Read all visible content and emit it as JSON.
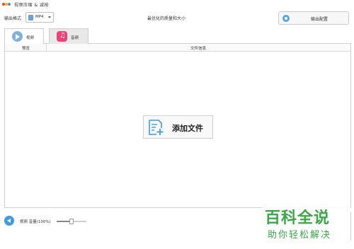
{
  "app": {
    "title": "视频压缩 & 减按",
    "logo_dots": [
      "#e94b3c",
      "#f4b400",
      "#4a90d9"
    ]
  },
  "toolbar": {
    "format_label": "输出格式",
    "format_value": "MP4",
    "quality_text": "最优化的质量和大小",
    "output_settings_label": "输出配置"
  },
  "tabs": [
    {
      "label": "视频",
      "icon": "play-icon",
      "active": true
    },
    {
      "label": "音频",
      "icon": "music-note-icon",
      "active": false
    }
  ],
  "list": {
    "col_preview": "预览",
    "col_file_info": "文件信息"
  },
  "add_file": {
    "label": "添加文件",
    "icon": "add-file-icon"
  },
  "bottom": {
    "volume_label": "视频 音量(100%)",
    "volume_percent": 100
  },
  "watermark": {
    "main": "百科全说",
    "sub": "助你轻松解决"
  },
  "colors": {
    "accent": "#3f9be0",
    "audio_tab": "#e9437a",
    "watermark": "#3aa845"
  }
}
